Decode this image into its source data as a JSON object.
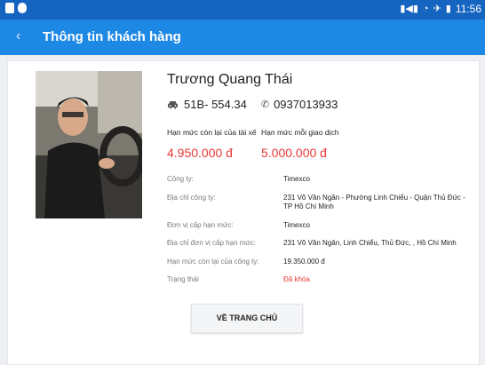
{
  "status_bar": {
    "time": "11:56"
  },
  "app_bar": {
    "title": "Thông tin khách hàng",
    "back_icon": "chevron-left-icon"
  },
  "customer": {
    "name": "Trương Quang Thái",
    "plate": "51B- 554.34",
    "phone": "0937013933"
  },
  "limits": {
    "driver_label": "Hạn mức còn lại của tài xế",
    "driver_value": "4.950.000 đ",
    "transaction_label": "Hạn mức mỗi giao dịch",
    "transaction_value": "5.000.000 đ"
  },
  "details": [
    {
      "label": "Công ty:",
      "value": "Timexco"
    },
    {
      "label": "Địa chỉ công ty:",
      "value": "231 Võ Văn Ngân - Phường Linh Chiểu - Quận Thủ Đức - TP Hồ Chí Minh"
    },
    {
      "label": "Đơn vị cấp hạn mức:",
      "value": "Timexco"
    },
    {
      "label": "Địa chỉ đơn vị cấp hạn mức:",
      "value": "231 Võ Văn Ngân, Linh Chiểu, Thủ Đức, , Hồ Chí Minh"
    },
    {
      "label": "Hạn mức còn lại của công ty:",
      "value": "19.350.000 đ"
    },
    {
      "label": "Trạng thái",
      "value": "Đã khóa"
    }
  ],
  "home_button": "VỀ TRANG CHỦ",
  "colors": {
    "app_bar": "#1e88e5",
    "status_bar": "#1565c0",
    "accent_red": "#e53935"
  }
}
